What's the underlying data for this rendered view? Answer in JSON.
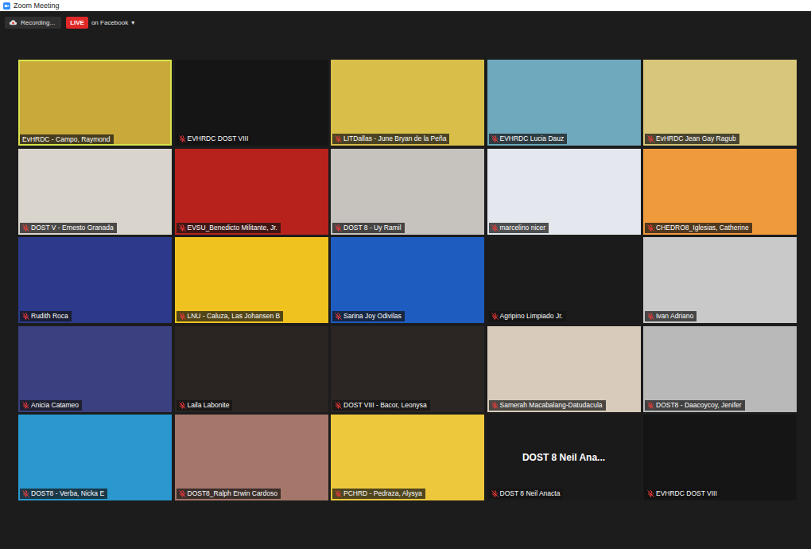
{
  "window": {
    "title": "Zoom Meeting"
  },
  "toolbar": {
    "recording": "Recording...",
    "live": "LIVE",
    "live_target": "on Facebook",
    "dropdown": "▾"
  },
  "tiles": [
    {
      "name": "EvHRDC - Campo, Raymond",
      "muted": false,
      "active": true,
      "kind": "video",
      "color": "#c9a93a"
    },
    {
      "name": "EVHRDC DOST VIII",
      "muted": true,
      "active": false,
      "kind": "video",
      "color": "#151515"
    },
    {
      "name": "LITDallas - June Bryan de la Peña",
      "muted": true,
      "active": false,
      "kind": "video",
      "color": "#d9bf4a"
    },
    {
      "name": "EVHRDC Lucia Dauz",
      "muted": true,
      "active": false,
      "kind": "video",
      "color": "#6fa9bd"
    },
    {
      "name": "EvHRDC Jean Gay Ragub",
      "muted": true,
      "active": false,
      "kind": "video",
      "color": "#d8c67a"
    },
    {
      "name": "DOST V - Ernesto Granada",
      "muted": true,
      "active": false,
      "kind": "video",
      "color": "#d9d5cd"
    },
    {
      "name": "EVSU_Benedicto Militante, Jr.",
      "muted": true,
      "active": false,
      "kind": "video",
      "color": "#b8221c"
    },
    {
      "name": "DOST 8 - Uy Ramil",
      "muted": true,
      "active": false,
      "kind": "video",
      "color": "#c6c3be"
    },
    {
      "name": "marcelino nicer",
      "muted": true,
      "active": false,
      "kind": "video",
      "color": "#e4e8ee"
    },
    {
      "name": "CHEDRO8_Iglesias, Catherine",
      "muted": true,
      "active": false,
      "kind": "video",
      "color": "#ef9a3c"
    },
    {
      "name": "Rudith Roca",
      "muted": true,
      "active": false,
      "kind": "video",
      "color": "#2b3a8a"
    },
    {
      "name": "LNU - Caluza, Las Johansen B",
      "muted": true,
      "active": false,
      "kind": "video",
      "color": "#efc21f"
    },
    {
      "name": "Sarina Joy Odivilas",
      "muted": true,
      "active": false,
      "kind": "video",
      "color": "#1f5cbf"
    },
    {
      "name": "Agripino Limpiado Jr.",
      "muted": true,
      "active": false,
      "kind": "video",
      "color": "#1b1b1b"
    },
    {
      "name": "Ivan Adriano",
      "muted": true,
      "active": false,
      "kind": "video",
      "color": "#c9c9c9"
    },
    {
      "name": "Anicia Catameo",
      "muted": true,
      "active": false,
      "kind": "video",
      "color": "#3a4080"
    },
    {
      "name": "Laila Labonite",
      "muted": true,
      "active": false,
      "kind": "video",
      "color": "#2a2522"
    },
    {
      "name": "DOST VIII - Bacor, Leonysa",
      "muted": true,
      "active": false,
      "kind": "video",
      "color": "#2b2624"
    },
    {
      "name": "Samerah Macabalang-Datudacula",
      "muted": true,
      "active": false,
      "kind": "video",
      "color": "#d8cbbb"
    },
    {
      "name": "DOST8 - Daacoycoy, Jenifer",
      "muted": true,
      "active": false,
      "kind": "video",
      "color": "#b9b9b9"
    },
    {
      "name": "DOST8 - Verba, Nicka E",
      "muted": true,
      "active": false,
      "kind": "video",
      "color": "#2a98cf"
    },
    {
      "name": "DOST8_Ralph Erwin Cardoso",
      "muted": true,
      "active": false,
      "kind": "video",
      "color": "#a5766a"
    },
    {
      "name": "PCHRD - Pedraza, Alysya",
      "muted": true,
      "active": false,
      "kind": "video",
      "color": "#eec83c"
    },
    {
      "name": "DOST 8 Neil Anacta",
      "muted": true,
      "active": false,
      "kind": "name-only",
      "color": "#1a1a1a",
      "display": "DOST 8 Neil Ana..."
    },
    {
      "name": "EVHRDC DOST VIII",
      "muted": true,
      "active": false,
      "kind": "video",
      "color": "#151515"
    }
  ]
}
